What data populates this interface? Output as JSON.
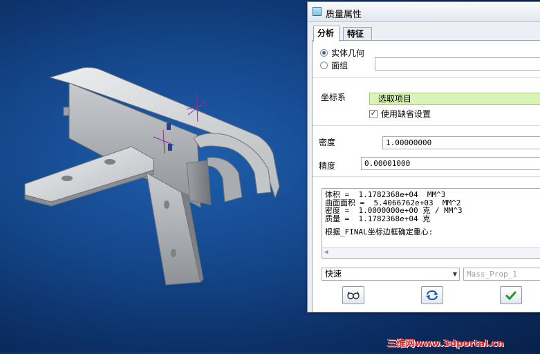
{
  "window": {
    "title": "质量属性"
  },
  "tabs": [
    {
      "label": "分析",
      "active": true
    },
    {
      "label": "特征",
      "active": false
    }
  ],
  "geometry": {
    "option_solid": {
      "label": "实体几何",
      "selected": true
    },
    "option_quilt": {
      "label": "面组",
      "selected": false
    },
    "quilt_value": ""
  },
  "coordinate_system": {
    "label": "坐标系",
    "selector_text": "选取项目",
    "use_default_label": "使用缺省设置",
    "use_default_checked": true
  },
  "density": {
    "label": "密度",
    "value": "1.00000000"
  },
  "accuracy": {
    "label": "精度",
    "value": "0.00001000"
  },
  "results": {
    "lines": [
      "体积 =  1.1782368e+04  MM^3",
      "曲面面积 =  5.4066762e+03  MM^2",
      "密度 =  1.0000000e+00 克 / MM^3",
      "质量 =  1.1782368e+04 克"
    ],
    "note": "根据_FINAL坐标边框确定重心:"
  },
  "method": {
    "selected": "快速"
  },
  "analysis_name": {
    "placeholder": "Mass_Prop_1"
  },
  "buttons": {
    "preview_icon": "glasses-icon",
    "repeat_icon": "repeat-arrows-icon",
    "ok_icon": "check-icon"
  },
  "colors": {
    "accent_green": "#d9f4b6",
    "ok_green": "#1f9a2a",
    "background": "#14468a",
    "watermark": "#e02020"
  },
  "watermark": {
    "text": "三维网www.3dportal.cn"
  }
}
